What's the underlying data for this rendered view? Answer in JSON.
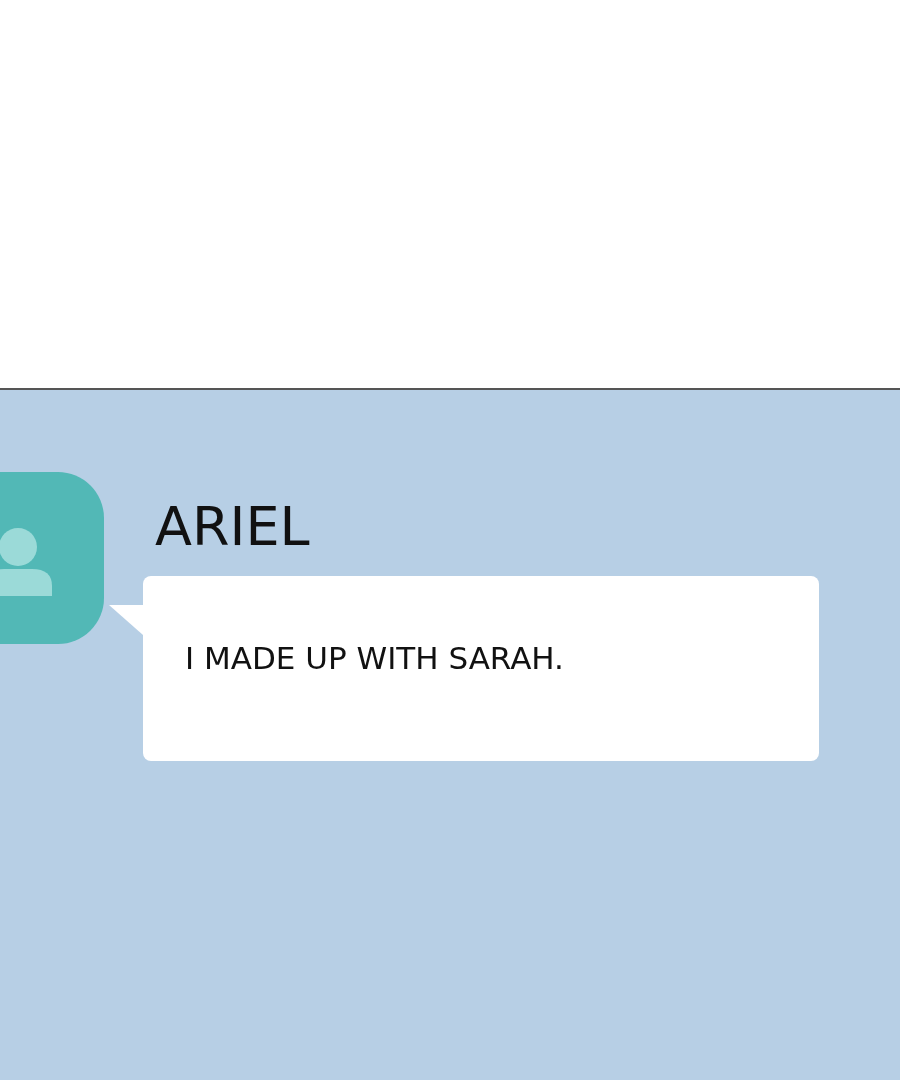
{
  "messages": [
    {
      "sender": "ARIEL",
      "text": "I MADE UP WITH SARAH."
    }
  ]
}
